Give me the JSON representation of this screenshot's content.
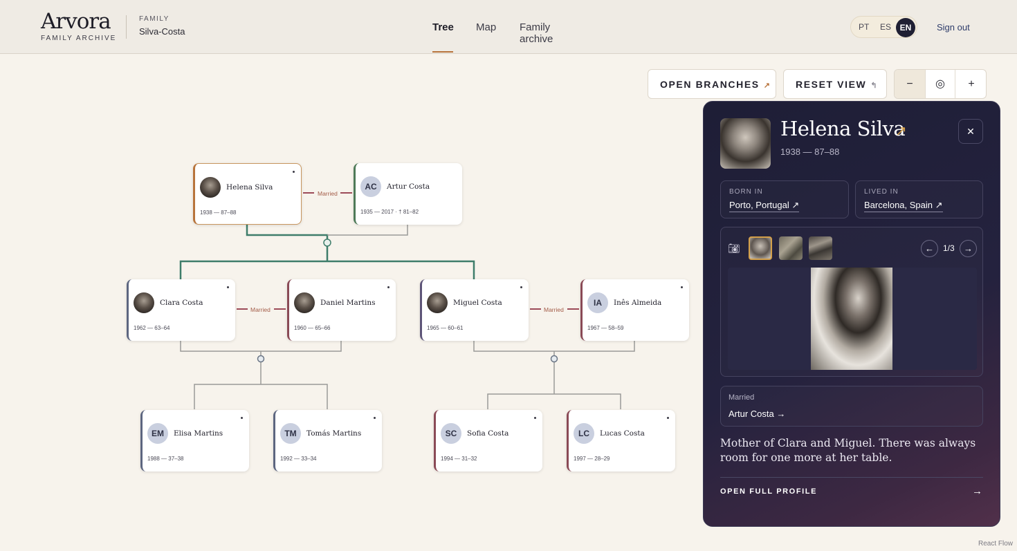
{
  "brand": {
    "name": "Arvora",
    "subtitle": "FAMILY ARCHIVE"
  },
  "family": {
    "label": "FAMILY",
    "name": "Silva-Costa"
  },
  "nav": {
    "items": [
      "Tree",
      "Map",
      "Family archive"
    ],
    "active": "Tree"
  },
  "languages": {
    "items": [
      "PT",
      "ES",
      "EN"
    ],
    "active": "EN"
  },
  "signout": "Sign out",
  "toolbar": {
    "open_branches": "OPEN BRANCHES",
    "open_branches_icon": "↗",
    "reset_view": "RESET VIEW",
    "reset_view_icon": "↰",
    "zoom_out": "−",
    "fit": "◎",
    "zoom_in": "+"
  },
  "tree": {
    "married_label": "Married",
    "nodes": {
      "helena": {
        "name": "Helena Silva",
        "dates": "1938 — 87–88",
        "avatar": "photo"
      },
      "artur": {
        "name": "Artur Costa",
        "dates": "1935 — 2017 · † 81–82",
        "initials": "AC"
      },
      "clara": {
        "name": "Clara Costa",
        "dates": "1962 — 63–64",
        "avatar": "photo"
      },
      "daniel": {
        "name": "Daniel Martins",
        "dates": "1960 — 65–66",
        "avatar": "photo"
      },
      "miguel": {
        "name": "Miguel Costa",
        "dates": "1965 — 60–61",
        "avatar": "photo"
      },
      "ines": {
        "name": "Inês Almeida",
        "dates": "1967 — 58–59",
        "initials": "IA"
      },
      "elisa": {
        "name": "Elisa Martins",
        "dates": "1988 — 37–38",
        "initials": "EM"
      },
      "tomas": {
        "name": "Tomás Martins",
        "dates": "1992 — 33–34",
        "initials": "TM"
      },
      "sofia": {
        "name": "Sofia Costa",
        "dates": "1994 — 31–32",
        "initials": "SC"
      },
      "lucas": {
        "name": "Lucas Costa",
        "dates": "1997 — 28–29",
        "initials": "LC"
      }
    }
  },
  "panel": {
    "name": "Helena Silva",
    "dates": "1938 — 87–88",
    "close": "✕",
    "born_label": "BORN IN",
    "born_value": "Porto, Portugal ↗",
    "lived_label": "LIVED IN",
    "lived_value": "Barcelona, Spain ↗",
    "gallery_count": "1/3",
    "prev": "←",
    "next": "→",
    "relation_label": "Married",
    "relation_value": "Artur Costa →",
    "description": "Mother of Clara and Miguel. There was always room for one more at her table.",
    "open_profile": "OPEN FULL PROFILE",
    "open_arrow": "→"
  },
  "footer": {
    "attribution": "React Flow"
  },
  "colors": {
    "accent": "#b8743c",
    "panel_bg": "#1e1e36",
    "branch_green": "#3e7d6a",
    "married_red": "#9c4a58"
  }
}
